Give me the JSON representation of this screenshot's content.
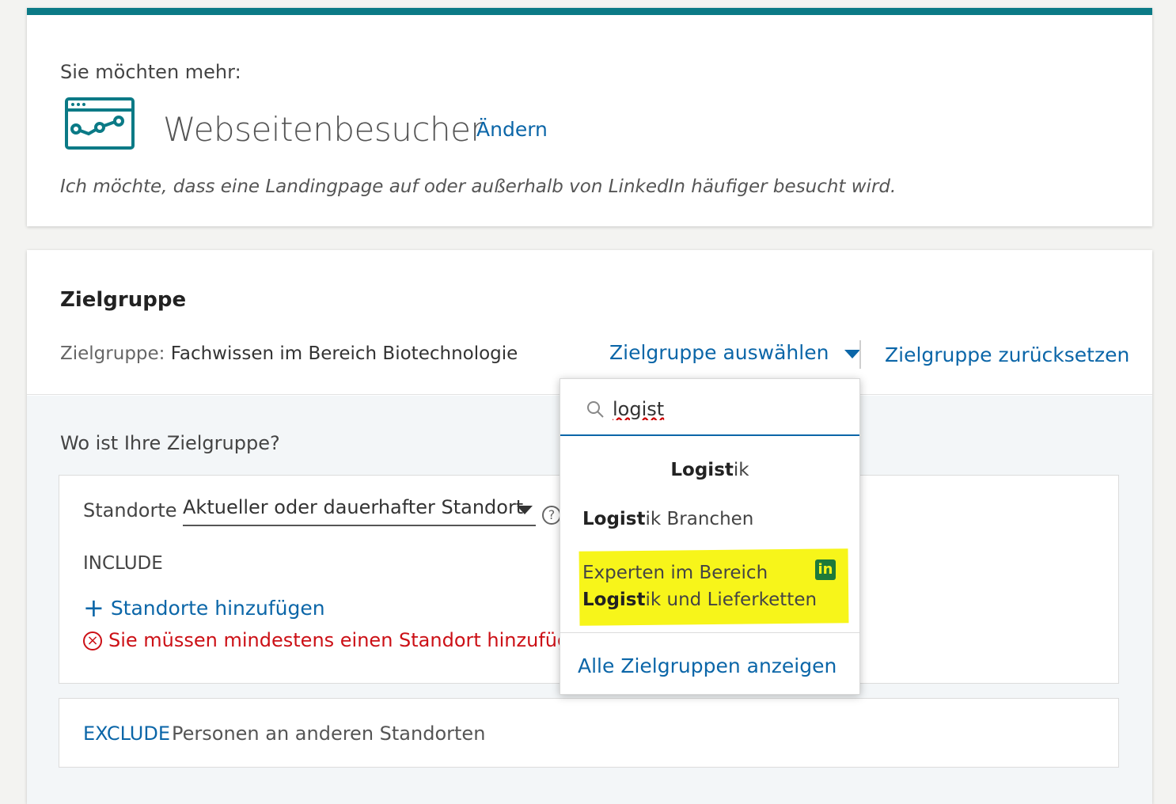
{
  "objective": {
    "label": "Sie möchten mehr:",
    "name": "Webseitenbesucher",
    "change_link": "Ändern",
    "description": "Ich möchte, dass eine Landingpage auf oder außerhalb von LinkedIn häufiger besucht wird.",
    "icon": "website-visits-icon"
  },
  "audience": {
    "title": "Zielgruppe",
    "summary_label": "Zielgruppe:",
    "summary_value": "Fachwissen im Bereich Biotechnologie",
    "select_label": "Zielgruppe auswählen",
    "reset_label": "Zielgruppe zurücksetzen"
  },
  "location": {
    "question": "Wo ist Ihre Zielgruppe?",
    "label": "Standorte",
    "select_value": "Aktueller oder dauerhafter Standort",
    "include_label": "INCLUDE",
    "add_label": "Standorte hinzufügen",
    "error": "Sie müssen mindestens einen Standort hinzufügen",
    "exclude_keyword": "EXCLUDE",
    "exclude_text": "Personen an anderen Standorten"
  },
  "dropdown": {
    "search_value": "logist",
    "items": [
      {
        "bold": "Logist",
        "rest": "ik"
      },
      {
        "bold": "Logist",
        "rest": "ik Branchen"
      },
      {
        "prefix": "Experten im Bereich",
        "bold": "Logist",
        "rest": "ik und Lieferketten",
        "badge": "in"
      }
    ],
    "footer": "Alle Zielgruppen anzeigen",
    "highlight_color": "#f7f51a"
  },
  "colors": {
    "accent": "#0b7a86",
    "link": "#0b66a8",
    "error": "#cc1016"
  }
}
